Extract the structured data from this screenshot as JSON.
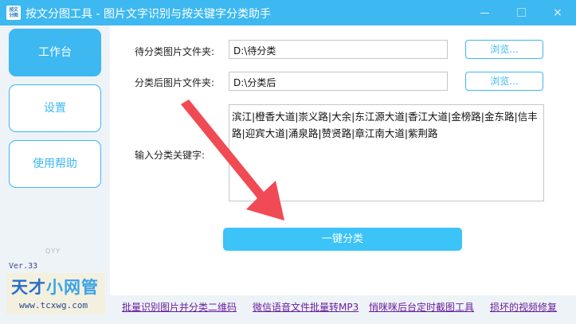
{
  "window": {
    "title": "按文分图工具 - 图片文字识别与按关键字分类助手",
    "icon_text": [
      "按文",
      "分图"
    ],
    "minimize_icon": "minimize-icon",
    "maximize_icon": "maximize-icon",
    "close_icon": "close-icon",
    "close_glyph": "×",
    "accent_color": "#3db8f0"
  },
  "sidebar": {
    "items": [
      {
        "label": "工作台",
        "active": true
      },
      {
        "label": "设置",
        "active": false
      },
      {
        "label": "使用帮助",
        "active": false
      }
    ],
    "watermark": "QYY",
    "version": "Ver.33",
    "logo": {
      "part1": "天才",
      "part2": "小网管",
      "url": "www.tcxwg.com"
    }
  },
  "form": {
    "source_label": "待分类图片文件夹:",
    "source_value": "D:\\待分类",
    "dest_label": "分类后图片文件夹:",
    "dest_value": "D:\\分类后",
    "browse_label": "浏览...",
    "keywords_label": "输入分类关键字:",
    "keywords_value": "滨江|橙香大道|崇义路|大余|东江源大道|香江大道|金榜路|金东路|信丰路|迎宾大道|涌泉路|赞贤路|章江南大道|紫荆路",
    "submit_label": "一键分类",
    "arrow_color": "#f04a55"
  },
  "footer": {
    "links": [
      "批量识别图片并分类二维码",
      "微信语音文件批量转MP3",
      "悄咪咪后台定时截图工具",
      "损坏的视频修复"
    ]
  }
}
